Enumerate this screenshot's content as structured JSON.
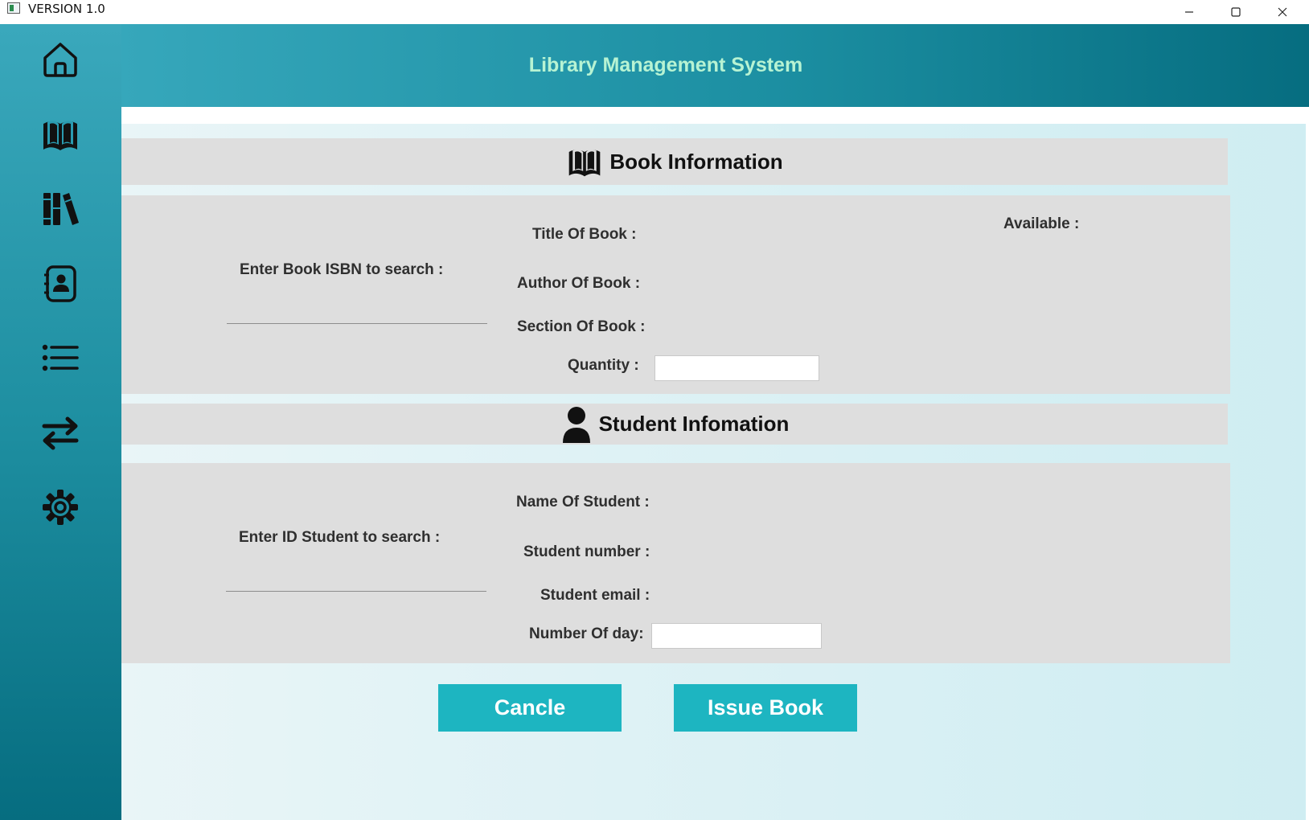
{
  "window": {
    "title": "VERSION 1.0",
    "controls": [
      "minimize-icon",
      "maximize-icon",
      "close-icon"
    ]
  },
  "header": {
    "title": "Library Management System"
  },
  "sidebar": {
    "items": [
      {
        "icon": "home-icon"
      },
      {
        "icon": "book-icon"
      },
      {
        "icon": "library-books-icon"
      },
      {
        "icon": "contact-book-icon"
      },
      {
        "icon": "list-icon"
      },
      {
        "icon": "transfer-arrows-icon"
      },
      {
        "icon": "settings-gear-icon"
      }
    ]
  },
  "book_section": {
    "title": "Book Information",
    "icon": "open-book-icon",
    "isbn_label": "Enter Book ISBN to search :",
    "isbn_value": "",
    "title_label": "Title Of Book :",
    "author_label": "Author Of Book :",
    "section_label": "Section Of Book :",
    "quantity_label": "Quantity :",
    "quantity_value": "",
    "available_label": "Available :"
  },
  "student_section": {
    "title": "Student Infomation",
    "icon": "person-icon",
    "id_label": "Enter ID Student to search :",
    "id_value": "",
    "name_label": "Name Of Student :",
    "number_label": "Student number :",
    "email_label": "Student email :",
    "days_label": "Number Of day:",
    "days_value": ""
  },
  "actions": {
    "cancel_label": "Cancle",
    "issue_label": "Issue Book"
  },
  "colors": {
    "sidebar_top": "#3aa8bc",
    "sidebar_bottom": "#066d80",
    "header_title": "#b7f3d3",
    "panel": "#dedede",
    "button": "#1db5c1"
  }
}
